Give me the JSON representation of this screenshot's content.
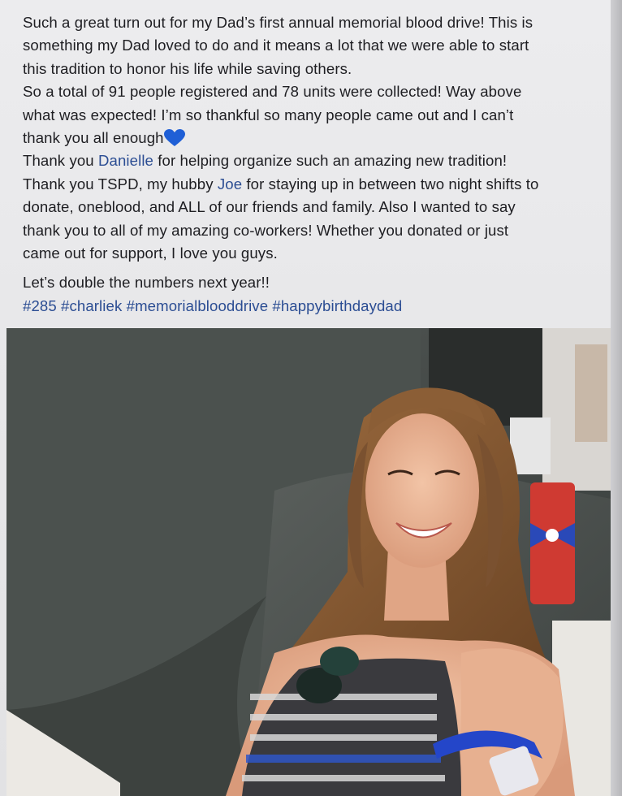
{
  "post": {
    "paragraph1": [
      "Such a great turn out for my Dad’s first annual memorial blood drive! This is",
      "something my Dad loved to do and it means a lot that we were able to start",
      "this tradition to honor his life while saving others."
    ],
    "paragraph2": [
      "So a total of 91 people registered and 78 units were collected! Way above",
      "what was expected! I’m so thankful so many people came out and I can’t"
    ],
    "paragraph2_end": "thank you all enough",
    "heart_emoji": "blue-heart-icon",
    "thanks1_prefix": "Thank you ",
    "thanks1_link": "Danielle",
    "thanks1_suffix": " for helping organize such an amazing new tradition!",
    "thanks2_prefix": "Thank you TSPD, my hubby ",
    "thanks2_link": "Joe",
    "thanks2_suffix": " for staying up in between two night shifts to",
    "thanks2_lines": [
      "donate, oneblood, and ALL of our friends and family. Also I wanted to say",
      "thank you to all of my amazing co-workers! Whether you donated or just",
      "came out for support, I love you guys."
    ],
    "closing": "Let’s double the numbers next year!!",
    "hashtags": [
      "#285",
      "#charliek",
      "#memorialblooddrive",
      "#happybirthdaydad"
    ]
  },
  "colors": {
    "link": "#2b4d93",
    "text": "#1e1e22",
    "heart": "#1f5fd6"
  }
}
